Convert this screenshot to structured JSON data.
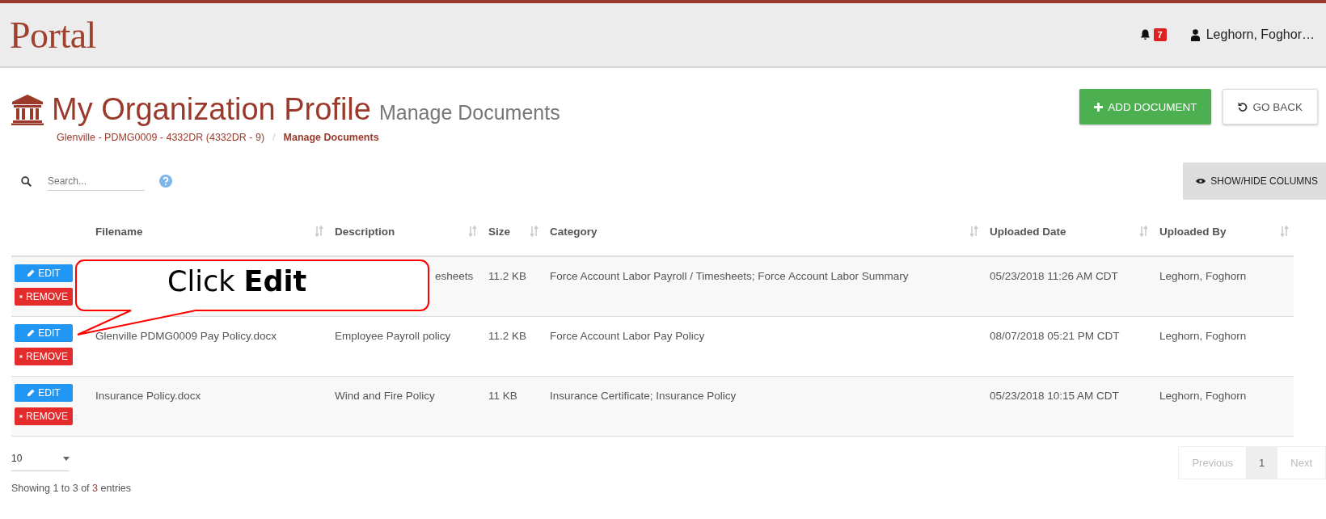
{
  "header": {
    "logo": "Portal",
    "notifications": {
      "count": "7"
    },
    "user": "Leghorn, Foghor…"
  },
  "page": {
    "title": "My Organization Profile",
    "subtitle": "Manage Documents",
    "breadcrumb_separator": "/",
    "breadcrumb": [
      {
        "label": "Glenville - PDMG0009 - 4332DR (4332DR - 9)",
        "selected": false
      },
      {
        "label": "Manage Documents",
        "selected": true
      }
    ],
    "buttons": [
      {
        "kind": "primary",
        "label": "ADD DOCUMENT"
      },
      {
        "kind": "default",
        "label": "GO BACK"
      }
    ]
  },
  "search": {
    "placeholder": "Search..."
  },
  "show_hide_columns": "SHOW/HIDE COLUMNS",
  "table": {
    "columns": [
      "Filename",
      "Description",
      "Size",
      "Category",
      "Uploaded Date",
      "Uploaded By"
    ],
    "rows": [
      {
        "filename": null,
        "description": "esheets",
        "covered": true,
        "size": "11.2 KB",
        "category": "Force Account Labor Payroll / Timesheets; Force Account Labor Summary",
        "uploaded_date": "05/23/2018 11:26 AM CDT",
        "uploaded_by": "Leghorn, Foghorn",
        "actions": [
          "EDIT",
          "REMOVE"
        ]
      },
      {
        "filename": "Glenville PDMG0009 Pay Policy.docx",
        "description": "Employee Payroll policy",
        "covered": false,
        "size": "11.2 KB",
        "category": "Force Account Labor Pay Policy",
        "uploaded_date": "08/07/2018 05:21 PM CDT",
        "uploaded_by": "Leghorn, Foghorn",
        "actions": [
          "EDIT",
          "REMOVE"
        ]
      },
      {
        "filename": "Insurance Policy.docx",
        "description": "Wind and Fire Policy",
        "covered": false,
        "size": "11 KB",
        "category": "Insurance Certificate; Insurance Policy",
        "uploaded_date": "05/23/2018 10:15 AM CDT",
        "uploaded_by": "Leghorn, Foghorn",
        "actions": [
          "EDIT",
          "REMOVE"
        ]
      }
    ]
  },
  "page_length": "10",
  "info": {
    "before": "Showing 1 to 3 of ",
    "count": "3",
    "after": " entries"
  },
  "pagination": [
    {
      "label": "Previous",
      "selected": false,
      "disabled": true
    },
    {
      "label": "1",
      "selected": true,
      "disabled": false
    },
    {
      "label": "Next",
      "selected": false,
      "disabled": true
    }
  ],
  "callout": {
    "text": "Click **Edit**"
  }
}
